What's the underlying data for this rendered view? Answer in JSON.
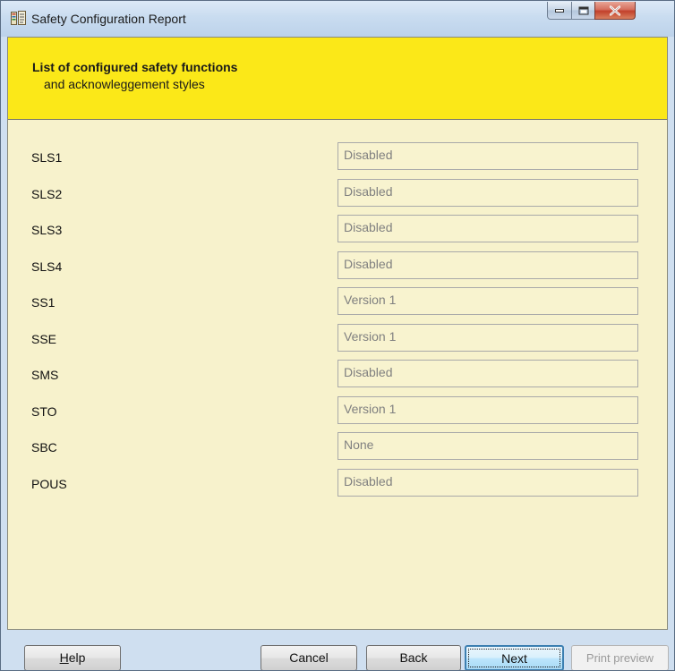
{
  "window": {
    "title": "Safety Configuration Report"
  },
  "header": {
    "title": "List of configured safety functions",
    "subtitle": "and acknowleggement styles"
  },
  "rows": [
    {
      "label": "SLS1",
      "value": "Disabled"
    },
    {
      "label": "SLS2",
      "value": "Disabled"
    },
    {
      "label": "SLS3",
      "value": "Disabled"
    },
    {
      "label": "SLS4",
      "value": "Disabled"
    },
    {
      "label": "SS1",
      "value": "Version 1"
    },
    {
      "label": "SSE",
      "value": "Version 1"
    },
    {
      "label": "SMS",
      "value": "Disabled"
    },
    {
      "label": "STO",
      "value": "Version 1"
    },
    {
      "label": "SBC",
      "value": "None"
    },
    {
      "label": "POUS",
      "value": "Disabled"
    }
  ],
  "buttons": {
    "help": "Help",
    "help_mnemonic": "H",
    "help_rest": "elp",
    "cancel": "Cancel",
    "back": "Back",
    "next": "Next",
    "print_preview": "Print preview"
  },
  "colors": {
    "header_band": "#fbe818",
    "content_bg": "#f7f2cc",
    "field_text": "#808080",
    "default_button_border": "#3c7fb1"
  },
  "icons": {
    "app": "report-app-icon",
    "minimize": "minimize-icon",
    "maximize": "maximize-icon",
    "close": "close-icon"
  }
}
